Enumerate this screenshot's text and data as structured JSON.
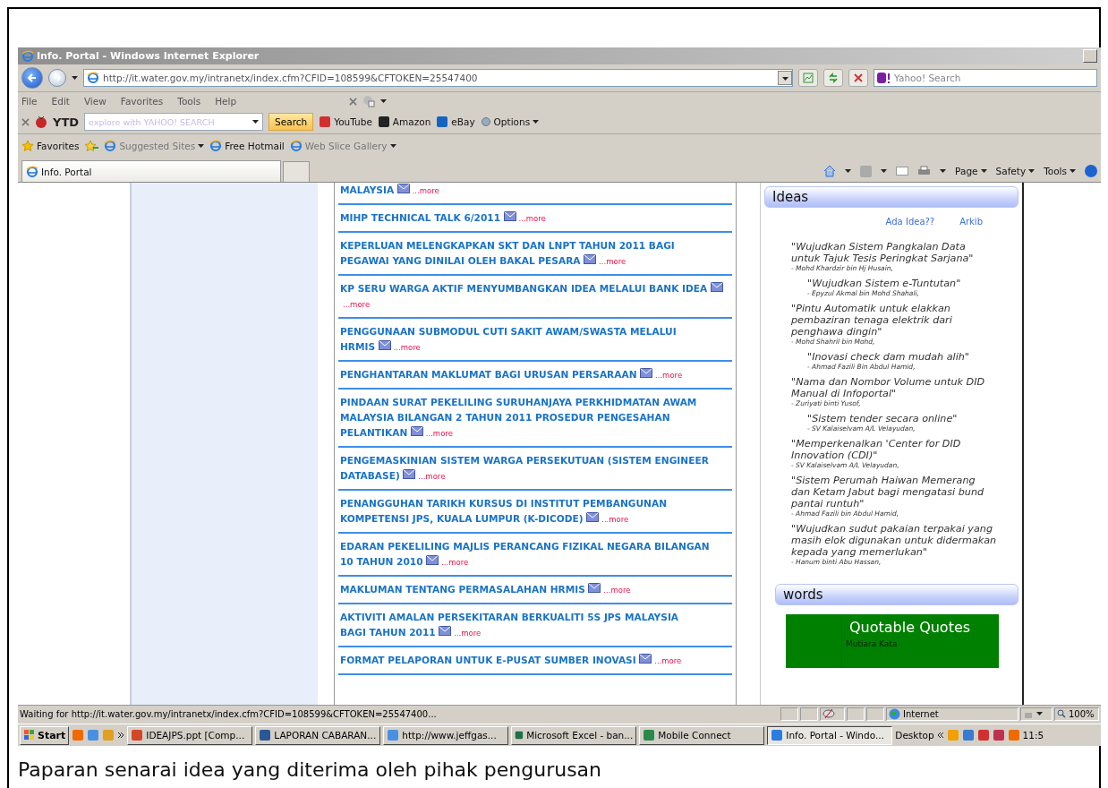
{
  "window": {
    "title": "Info. Portal - Windows Internet Explorer"
  },
  "address_bar": {
    "url": "http://it.water.gov.my/intranetx/index.cfm?CFID=108599&CFTOKEN=25547400",
    "search_placeholder": "Yahoo! Search"
  },
  "menu": [
    "File",
    "Edit",
    "View",
    "Favorites",
    "Tools",
    "Help"
  ],
  "yahoo_toolbar": {
    "brand": "YTD",
    "search_placeholder": "explore with YAHOO! SEARCH",
    "search_button": "Search",
    "links": [
      "YouTube",
      "Amazon",
      "eBay"
    ],
    "options": "Options"
  },
  "favorites_bar": {
    "label": "Favorites",
    "items": [
      {
        "label": "Suggested Sites",
        "has_menu": true
      },
      {
        "label": "Free Hotmail",
        "has_menu": false
      },
      {
        "label": "Web Slice Gallery",
        "has_menu": true
      }
    ]
  },
  "tab": {
    "title": "Info. Portal"
  },
  "command_bar": [
    "Page",
    "Safety",
    "Tools"
  ],
  "news": [
    {
      "title_lines": [
        "MALAYSIA"
      ],
      "more": "...more"
    },
    {
      "title_lines": [
        "MIHP TECHNICAL TALK 6/2011"
      ],
      "more": "...more"
    },
    {
      "title_lines": [
        "KEPERLUAN MELENGKAPKAN SKT DAN LNPT TAHUN 2011 BAGI",
        "PEGAWAI YANG DINILAI OLEH BAKAL PESARA"
      ],
      "more": "...more"
    },
    {
      "title_lines": [
        "KP SERU WARGA AKTIF MENYUMBANGKAN IDEA MELALUI BANK IDEA"
      ],
      "more": "...more"
    },
    {
      "title_lines": [
        "PENGGUNAAN SUBMODUL CUTI SAKIT AWAM/SWASTA MELALUI",
        "HRMIS"
      ],
      "more": "...more"
    },
    {
      "title_lines": [
        "PENGHANTARAN MAKLUMAT BAGI URUSAN PERSARAAN"
      ],
      "more": "...more"
    },
    {
      "title_lines": [
        "PINDAAN SURAT PEKELILING SURUHANJAYA PERKHIDMATAN AWAM",
        "MALAYSIA BILANGAN 2 TAHUN 2011 PROSEDUR PENGESAHAN",
        "PELANTIKAN"
      ],
      "more": "...more"
    },
    {
      "title_lines": [
        "PENGEMASKINIAN SISTEM WARGA PERSEKUTUAN (SISTEM ENGINEER",
        "DATABASE)"
      ],
      "more": "...more"
    },
    {
      "title_lines": [
        "PENANGGUHAN TARIKH KURSUS DI INSTITUT PEMBANGUNAN",
        "KOMPETENSI JPS, KUALA LUMPUR (K-DICODE)"
      ],
      "more": "...more"
    },
    {
      "title_lines": [
        "EDARAN PEKELILING MAJLIS PERANCANG FIZIKAL NEGARA BILANGAN",
        "10 TAHUN 2010"
      ],
      "more": "...more"
    },
    {
      "title_lines": [
        "MAKLUMAN TENTANG PERMASALAHAN HRMIS"
      ],
      "more": "...more"
    },
    {
      "title_lines": [
        "AKTIVITI AMALAN PERSEKITARAN BERKUALITI 5S JPS MALAYSIA",
        "BAGI TAHUN 2011"
      ],
      "more": "...more"
    },
    {
      "title_lines": [
        "FORMAT PELAPORAN UNTUK E-PUSAT SUMBER INOVASI"
      ],
      "more": "...more"
    }
  ],
  "ideas": {
    "title": "Ideas",
    "links": [
      "Ada Idea??",
      "Arkib"
    ],
    "entries": [
      {
        "quote": "\"Wujudkan Sistem Pangkalan Data untuk Tajuk Tesis Peringkat Sarjana\"",
        "author": "- Mohd Khardzir bin Hj Husain,",
        "centered": false
      },
      {
        "quote": "\"Wujudkan Sistem e-Tuntutan\"",
        "author": "- Epyzul Akmal bin Mohd Shahali,",
        "centered": true
      },
      {
        "quote": "\"Pintu Automatik untuk elakkan pembaziran tenaga elektrik dari penghawa dingin\"",
        "author": "- Mohd Shahril bin Mohd,",
        "centered": false
      },
      {
        "quote": "\"Inovasi check dam mudah alih\"",
        "author": "- Ahmad Fazili Bin Abdul Hamid,",
        "centered": true
      },
      {
        "quote": "\"Nama dan Nombor Volume untuk DID Manual di Infoportal\"",
        "author": "- Zuriyati binti Yusof,",
        "centered": false
      },
      {
        "quote": "\"Sistem tender secara online\"",
        "author": "- SV Kalaiselvam A/L Velayudan,",
        "centered": true
      },
      {
        "quote": "\"Memperkenalkan 'Center for DID Innovation (CDI)\"",
        "author": "- SV Kalaiselvam A/L Velayudan,",
        "centered": false
      },
      {
        "quote": "\"Sistem Perumah Haiwan Memerang dan Ketam Jabut bagi mengatasi bund pantai runtuh\"",
        "author": "- Ahmad Fazili bin Abdul Hamid,",
        "centered": false
      },
      {
        "quote": "\"Wujudkan sudut pakaian terpakai yang masih elok digunakan untuk didermakan kepada yang memerlukan\"",
        "author": "- Hanum binti Abu Hassan,",
        "centered": false
      }
    ]
  },
  "words": {
    "title": "words",
    "quote_title": "Quotable Quotes",
    "quote_subtitle": "Mutiara Kata"
  },
  "status_bar": {
    "text": "Waiting for http://it.water.gov.my/intranetx/index.cfm?CFID=108599&CFTOKEN=25547400...",
    "zone": "Internet",
    "zoom": "100%"
  },
  "taskbar": {
    "start": "Start",
    "tasks": [
      {
        "label": "IDEAJPS.ppt [Comp...",
        "kind": "ppt",
        "selected": false
      },
      {
        "label": "LAPORAN CABARAN...",
        "kind": "word",
        "selected": false
      },
      {
        "label": "http://www.jeffgas...",
        "kind": "browser",
        "selected": false
      },
      {
        "label": "Microsoft Excel - ban...",
        "kind": "excel",
        "selected": false
      },
      {
        "label": "Mobile Connect",
        "kind": "mobile",
        "selected": false
      },
      {
        "label": "Info. Portal - Windo...",
        "kind": "ie",
        "selected": true
      }
    ],
    "desktop": "Desktop",
    "clock": "11:5"
  },
  "caption": "Paparan senarai idea yang diterima oleh pihak pengurusan"
}
